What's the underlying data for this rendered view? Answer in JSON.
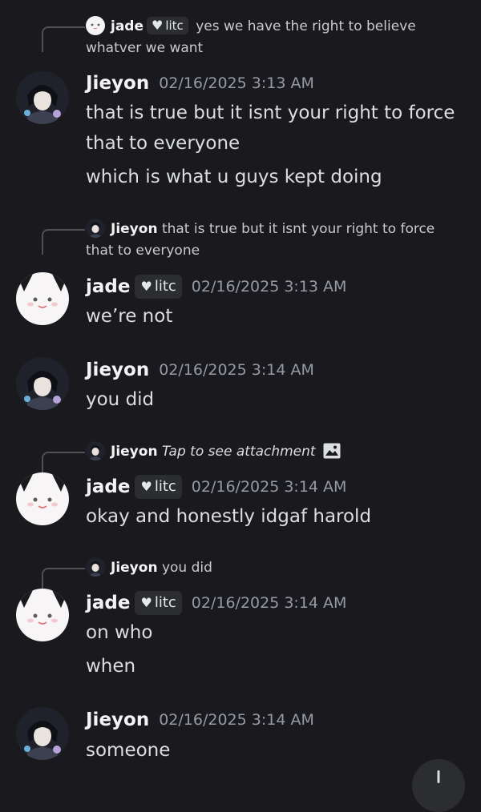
{
  "tag_label": "litc",
  "messages": {
    "r1": {
      "name": "jade",
      "text": "yes we have the right to believe whatver we want"
    },
    "m1": {
      "name": "Jieyon",
      "time": "02/16/2025 3:13 AM",
      "lines": [
        "that is true but it isnt your right to force",
        "that to everyone",
        "which is what u guys kept doing"
      ]
    },
    "r2": {
      "name": "Jieyon",
      "text": "that is true but it isnt your right to force that to everyone"
    },
    "m2": {
      "name": "jade",
      "time": "02/16/2025 3:13 AM",
      "lines": [
        "we’re not"
      ]
    },
    "m3": {
      "name": "Jieyon",
      "time": "02/16/2025 3:14 AM",
      "lines": [
        "you did"
      ]
    },
    "r4": {
      "name": "Jieyon",
      "text": "Tap to see attachment"
    },
    "m4": {
      "name": "jade",
      "time": "02/16/2025 3:14 AM",
      "lines": [
        "okay and honestly idgaf harold"
      ]
    },
    "r5": {
      "name": "Jieyon",
      "text": "you did"
    },
    "m5": {
      "name": "jade",
      "time": "02/16/2025 3:14 AM",
      "lines": [
        "on who",
        "when"
      ]
    },
    "m6": {
      "name": "Jieyon",
      "time": "02/16/2025 3:14 AM",
      "lines": [
        "someone"
      ]
    }
  },
  "icons": {
    "attachment": "image-icon",
    "jump": "scroll-down-button"
  }
}
